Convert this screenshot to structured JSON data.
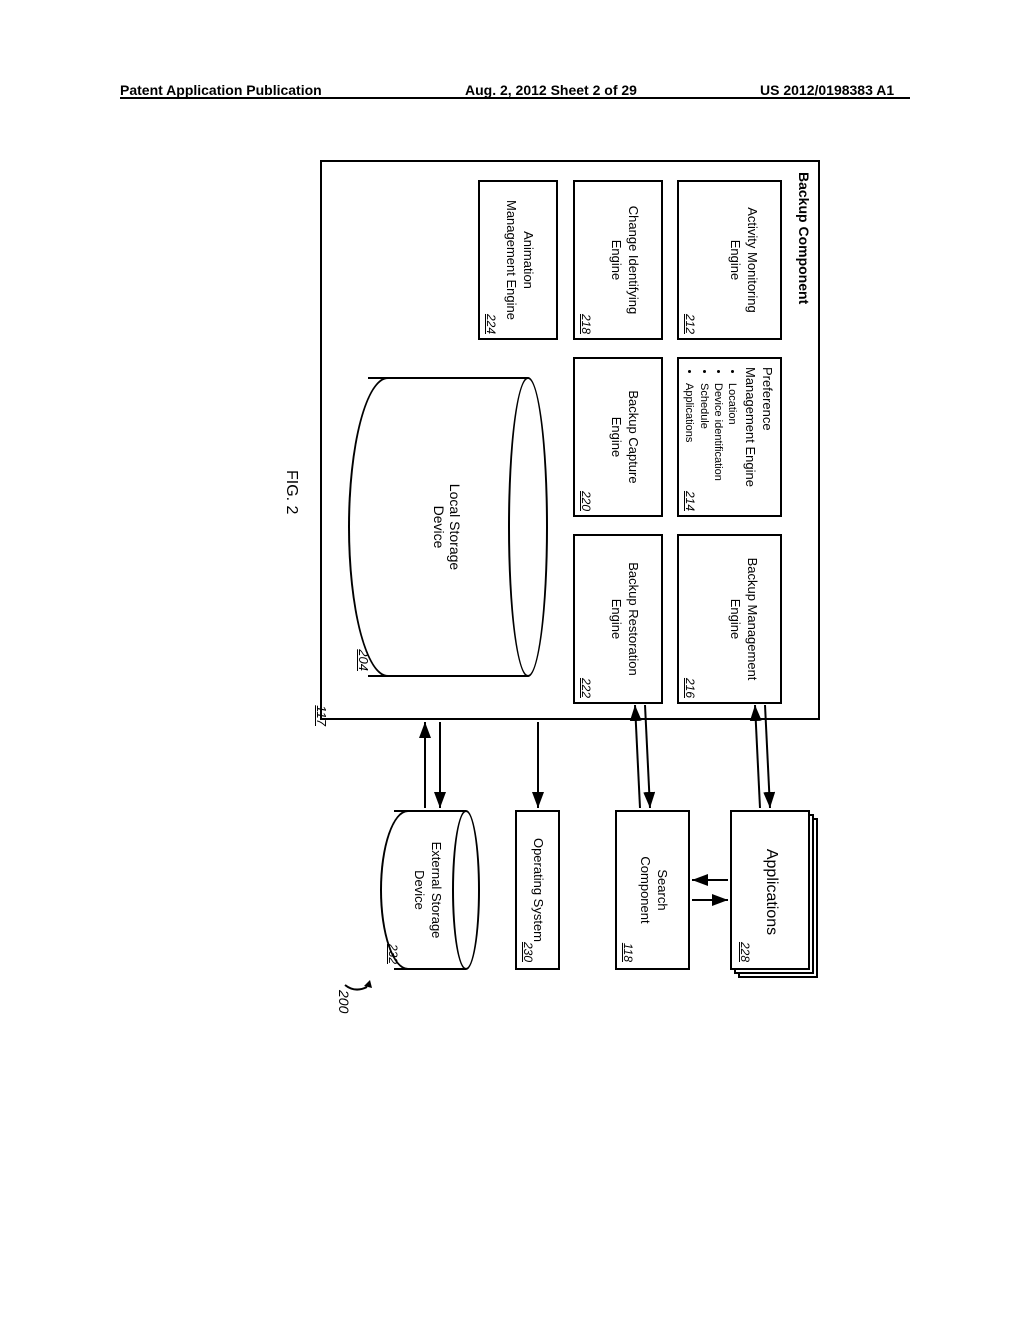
{
  "header": {
    "left": "Patent Application Publication",
    "mid": "Aug. 2, 2012  Sheet 2 of 29",
    "right": "US 2012/0198383 A1"
  },
  "diagram": {
    "backup_component": {
      "title": "Backup Component",
      "ref": "117"
    },
    "engines": {
      "e212": {
        "label": "Activity Monitoring\nEngine",
        "ref": "212"
      },
      "e214": {
        "label": "Preference\nManagement Engine",
        "bullets": [
          "Location",
          "Device identification",
          "Schedule",
          "Applications"
        ],
        "ref": "214"
      },
      "e216": {
        "label": "Backup Management\nEngine",
        "ref": "216"
      },
      "e218": {
        "label": "Change Identifying\nEngine",
        "ref": "218"
      },
      "e220": {
        "label": "Backup Capture\nEngine",
        "ref": "220"
      },
      "e222": {
        "label": "Backup Restoration\nEngine",
        "ref": "222"
      },
      "e224": {
        "label": "Animation\nManagement Engine",
        "ref": "224"
      }
    },
    "local_storage": {
      "label": "Local Storage\nDevice",
      "ref": "204"
    },
    "applications": {
      "label": "Applications",
      "ref": "228"
    },
    "search_component": {
      "label": "Search\nComponent",
      "ref": "118"
    },
    "operating_system": {
      "label": "Operating System",
      "ref": "230"
    },
    "external_storage": {
      "label": "External Storage\nDevice",
      "ref": "232"
    },
    "ref200": "200",
    "fig_label": "FIG. 2"
  }
}
